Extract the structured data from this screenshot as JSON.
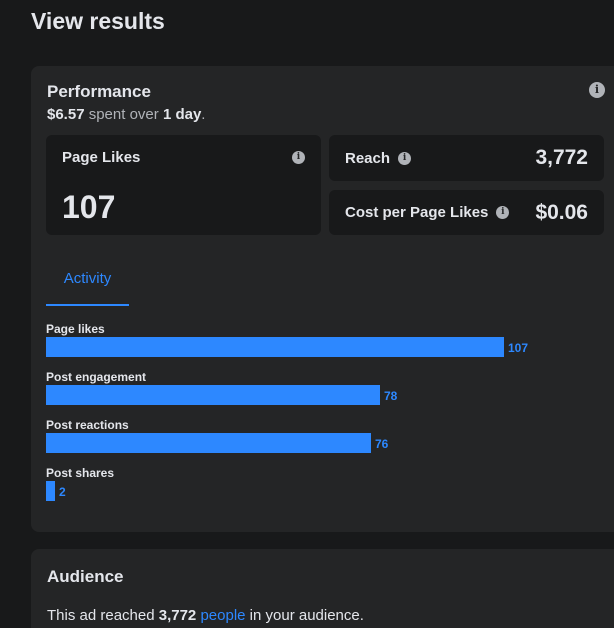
{
  "page": {
    "title": "View results"
  },
  "performance": {
    "title": "Performance",
    "spent": "$6.57",
    "spent_mid": " spent over ",
    "duration": "1 day",
    "spent_end": ".",
    "page_likes": {
      "label": "Page Likes",
      "value": "107"
    },
    "reach": {
      "label": "Reach",
      "value": "3,772"
    },
    "cost": {
      "label": "Cost per Page Likes",
      "value": "$0.06"
    },
    "tab_label": "Activity"
  },
  "chart_data": {
    "type": "bar",
    "orientation": "horizontal",
    "categories": [
      "Page likes",
      "Post engagement",
      "Post reactions",
      "Post shares"
    ],
    "values": [
      107,
      78,
      76,
      2
    ],
    "value_labels": [
      "107",
      "78",
      "76",
      "2"
    ]
  },
  "audience": {
    "title": "Audience",
    "text_pre": "This ad reached ",
    "count": "3,772",
    "text_gap": " ",
    "link": "people",
    "text_post": " in your audience."
  },
  "colors": {
    "accent": "#2d88ff",
    "card": "#242526",
    "background": "#18191a"
  }
}
